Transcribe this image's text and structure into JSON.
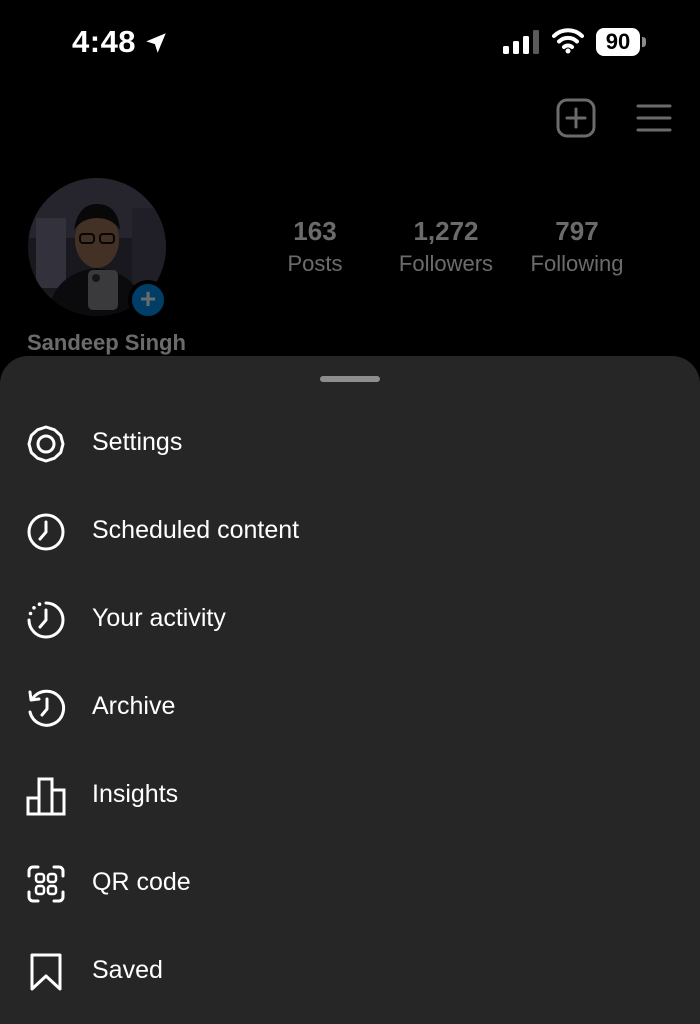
{
  "status_bar": {
    "time": "4:48",
    "battery": "90"
  },
  "profile": {
    "name": "Sandeep Singh",
    "stats": [
      {
        "value": "163",
        "label": "Posts"
      },
      {
        "value": "1,272",
        "label": "Followers"
      },
      {
        "value": "797",
        "label": "Following"
      }
    ],
    "avatar_add": "+"
  },
  "menu": {
    "items": [
      {
        "label": "Settings",
        "icon": "settings-icon"
      },
      {
        "label": "Scheduled content",
        "icon": "clock-icon"
      },
      {
        "label": "Your activity",
        "icon": "activity-icon"
      },
      {
        "label": "Archive",
        "icon": "archive-icon"
      },
      {
        "label": "Insights",
        "icon": "insights-icon"
      },
      {
        "label": "QR code",
        "icon": "qr-code-icon"
      },
      {
        "label": "Saved",
        "icon": "bookmark-icon"
      }
    ]
  },
  "colors": {
    "sheet": "#262626",
    "accent": "#0095f6",
    "background": "#000000"
  }
}
